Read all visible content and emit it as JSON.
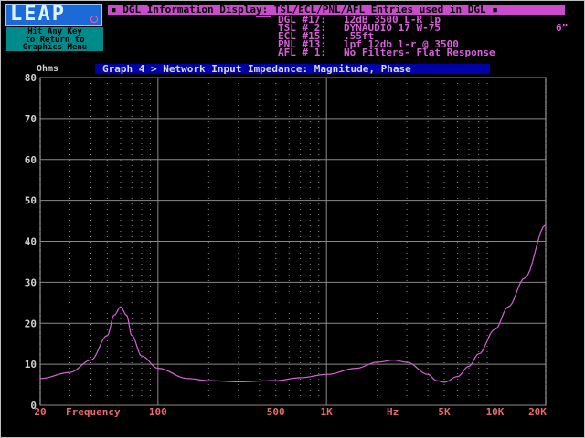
{
  "header": {
    "logo_text": "LEAP",
    "hint_lines": [
      "Hit Any Key",
      "to Return to",
      "Graphics Menu"
    ],
    "info_title": "▪ DGL Information Display: TSL/ECL/PNL/AFL Entries used in DGL ▪",
    "info_labels": [
      "DGL #17:",
      "TSL # 2:",
      "ECL #15:",
      "PNL #13:",
      "AFL # 1:"
    ],
    "info_values": [
      "12dB 3500 L-R lp",
      "DYNAUDIO 17 W-75",
      ".55ft",
      "lpf 12db l-r @ 3500",
      "No Filters- Flat Response"
    ],
    "size_note": "6”"
  },
  "graph": {
    "unit_label": "Ohms",
    "title": "Graph 4 > Network Input Impedance: Magnitude, Phase",
    "x_axis_name": "Frequency",
    "x_unit_mark": "Hz"
  },
  "colors": {
    "background": "#000000",
    "grid": "#8a8a8a",
    "curve": "#d95fd9",
    "x_labels": "#e86a6a",
    "y_labels": "#cfcfcf"
  },
  "chart_data": {
    "type": "line",
    "title": "Graph 4 > Network Input Impedance: Magnitude, Phase",
    "xlabel": "Frequency",
    "ylabel": "Ohms",
    "xscale": "log",
    "xlim": [
      20,
      20000
    ],
    "ylim": [
      0,
      80
    ],
    "grid": true,
    "y_ticks": [
      0,
      10,
      20,
      30,
      40,
      50,
      60,
      70,
      80
    ],
    "x_ticks": [
      {
        "value": 20,
        "label": "20"
      },
      {
        "value": 100,
        "label": "100"
      },
      {
        "value": 500,
        "label": "500"
      },
      {
        "value": 1000,
        "label": "1K"
      },
      {
        "value": 5000,
        "label": "5K"
      },
      {
        "value": 10000,
        "label": "10K"
      },
      {
        "value": 20000,
        "label": "20K"
      }
    ],
    "series": [
      {
        "x": [
          20,
          30,
          40,
          50,
          55,
          60,
          65,
          70,
          80,
          100,
          150,
          200,
          300,
          500,
          700,
          1000,
          1500,
          2000,
          2500,
          3000,
          4000,
          4500,
          5000,
          6000,
          7000,
          8000,
          10000,
          12000,
          15000,
          20000
        ],
        "y": [
          6.5,
          8,
          11,
          17,
          22,
          24,
          22,
          17,
          12,
          9,
          6.5,
          6,
          5.7,
          6,
          6.7,
          7.5,
          9,
          10.5,
          11,
          10.5,
          7.5,
          6,
          5.6,
          7,
          9.5,
          12.5,
          18.5,
          24,
          31,
          44
        ]
      }
    ]
  }
}
